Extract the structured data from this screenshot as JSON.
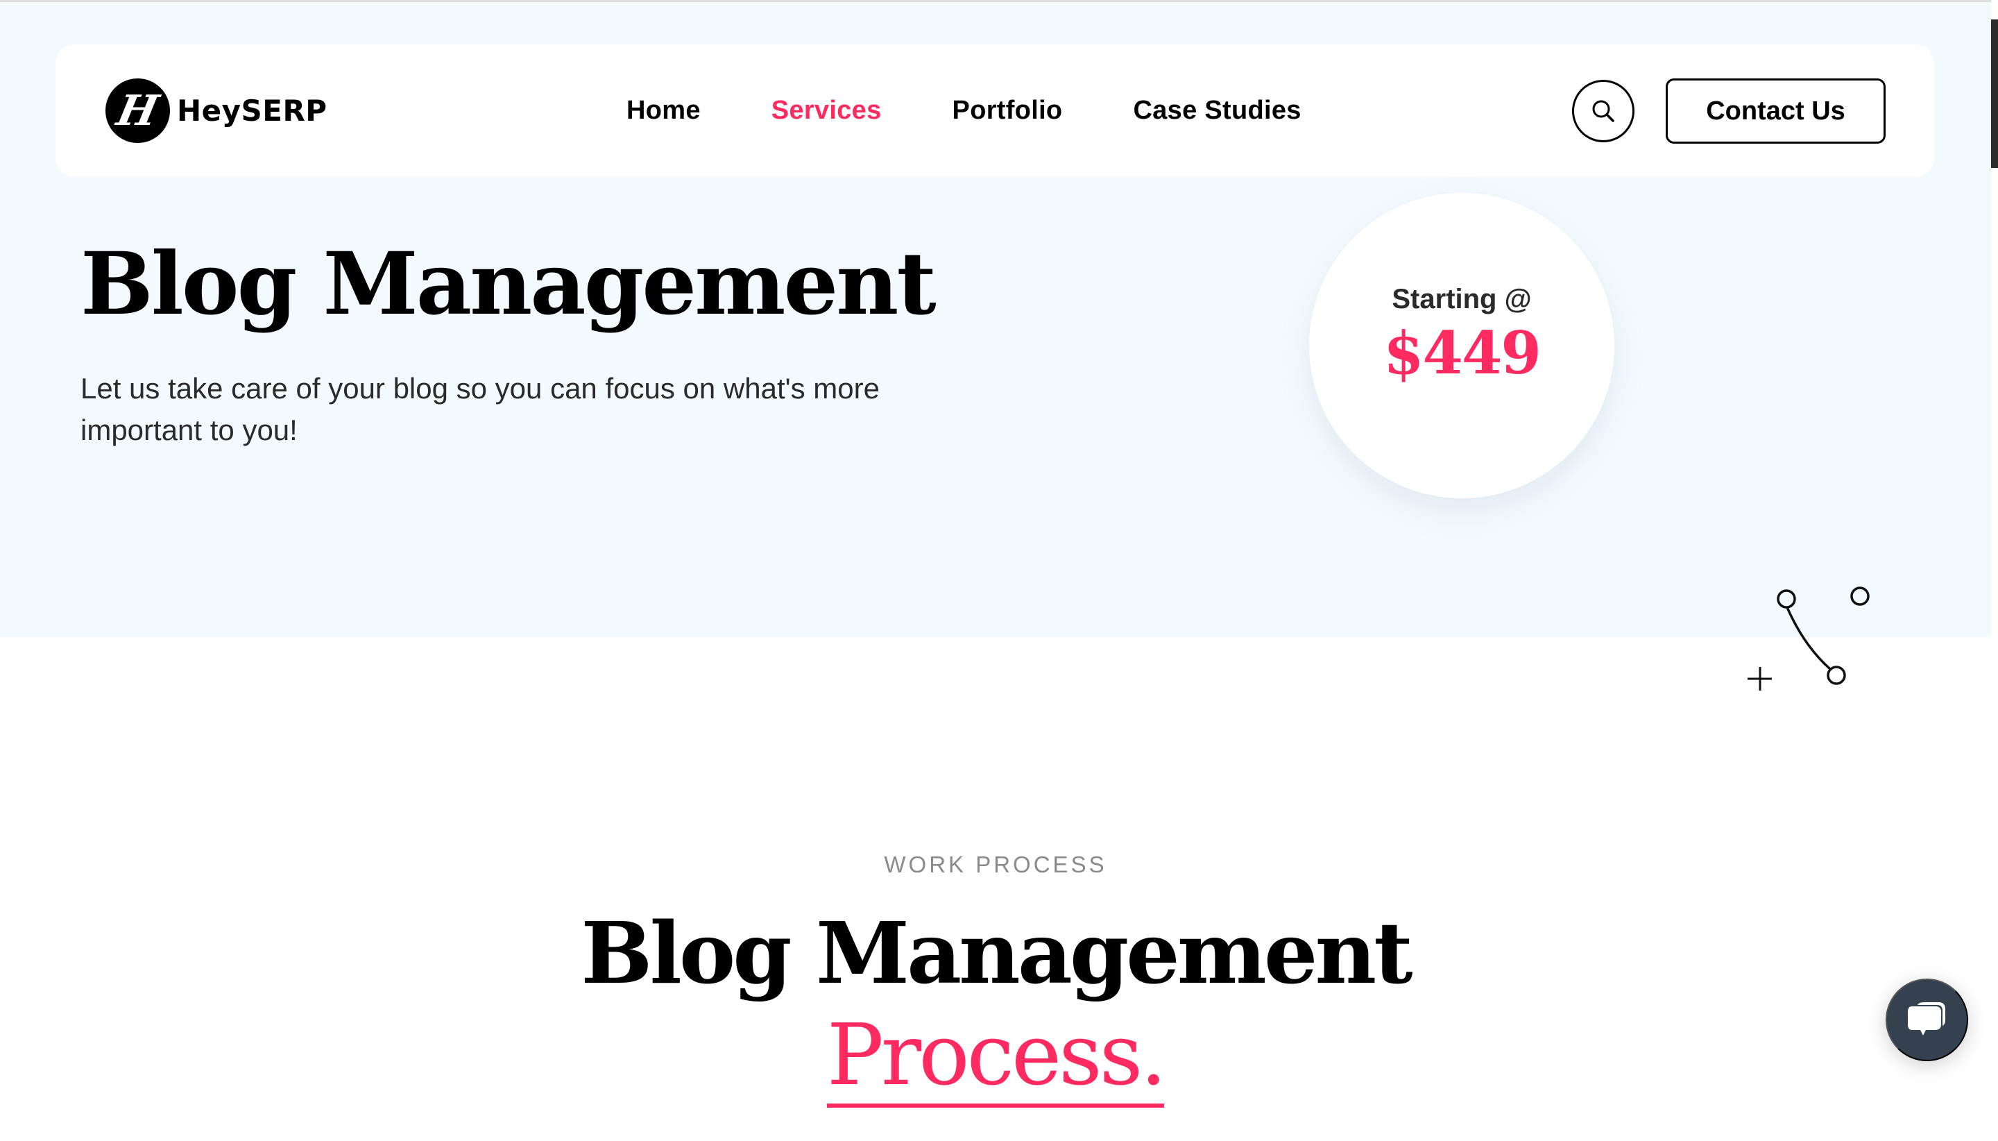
{
  "brand": {
    "logo_letter": "H",
    "name": "HeySERP"
  },
  "nav": {
    "items": [
      {
        "label": "Home",
        "active": false
      },
      {
        "label": "Services",
        "active": true
      },
      {
        "label": "Portfolio",
        "active": false
      },
      {
        "label": "Case Studies",
        "active": false
      }
    ],
    "search_icon": "search-icon",
    "contact_label": "Contact Us"
  },
  "hero": {
    "title": "Blog Management",
    "subtitle": "Let us take care of your blog so you can focus on what's more important to you!",
    "price_label": "Starting @",
    "price_value": "$449"
  },
  "work_process": {
    "eyebrow": "WORK PROCESS",
    "title": "Blog Management",
    "accent": "Process."
  },
  "chat_widget": {
    "icon": "chat-bubbles-icon"
  },
  "colors": {
    "accent": "#ff2a5f",
    "hero_background": "#f4f9fd",
    "chat_widget": "#35414e",
    "text": "#000000",
    "muted": "#8a8a8a"
  }
}
